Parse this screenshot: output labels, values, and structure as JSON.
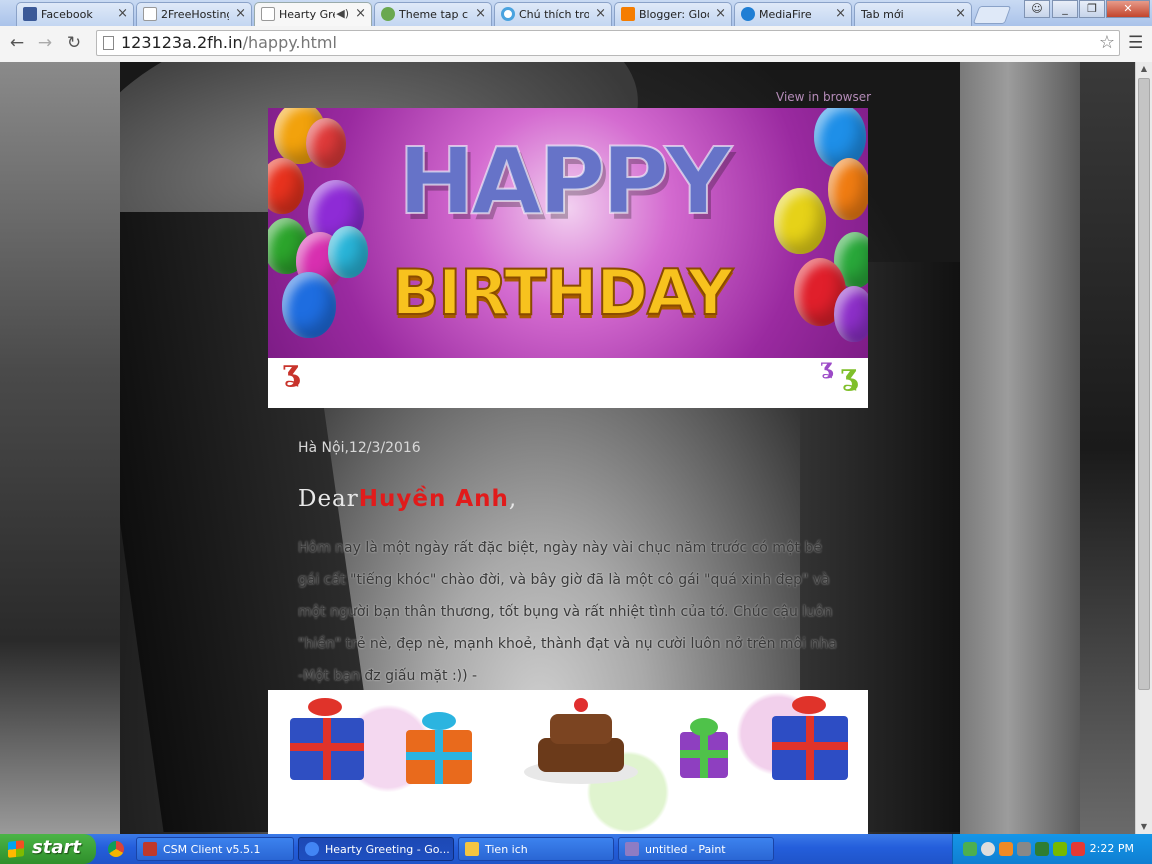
{
  "browser": {
    "tabs": [
      {
        "label": "Facebook",
        "color": "#3b5998"
      },
      {
        "label": "2FreeHosting",
        "color": "#dddddd"
      },
      {
        "label": "Hearty Gre",
        "color": "#ffffff",
        "active": true
      },
      {
        "label": "Theme tap chí",
        "color": "#6aa84f"
      },
      {
        "label": "Chú thích tron",
        "color": "#4aa3df"
      },
      {
        "label": "Blogger: Gloo",
        "color": "#f57d00"
      },
      {
        "label": "MediaFire",
        "color": "#1f7ed4"
      },
      {
        "label": "Tab mới",
        "color": "#eeeeee"
      }
    ],
    "url_host": "123123a.2fh.in",
    "url_path": "/happy.html"
  },
  "page": {
    "view_in_browser": "View in browser",
    "banner_happy": "HAPPY",
    "banner_birthday": "BIRTHDAY",
    "date": "Hà Nội,12/3/2016",
    "greeting_prefix": "Dear",
    "greeting_name": "Huyền Anh",
    "greeting_suffix": ",",
    "message": "Hôm nay là một ngày rất đặc biệt, ngày này vài chục năm trước có một bé gái cất \"tiếng khóc\" chào đời, và bây giờ đã là một cô gái \"quá xinh đẹp\" và một người bạn thân thương, tốt bụng và rất nhiệt tình của tớ. Chúc cậu luôn \"hiền\" trẻ nè, đẹp nè, mạnh khoẻ, thành đạt và nụ cười luôn nở trên môi nha -Một bạn đz giấu mặt :)) -"
  },
  "taskbar": {
    "start_label": "start",
    "buttons": [
      {
        "label": "CSM Client v5.5.1",
        "color": "#c0392b"
      },
      {
        "label": "Hearty Greeting - Go...",
        "color": "#4285f4",
        "active": true
      },
      {
        "label": "Tien ich",
        "color": "#f4c542"
      },
      {
        "label": "untitled - Paint",
        "color": "#8e7cc3"
      }
    ],
    "clock": "2:22 PM"
  }
}
